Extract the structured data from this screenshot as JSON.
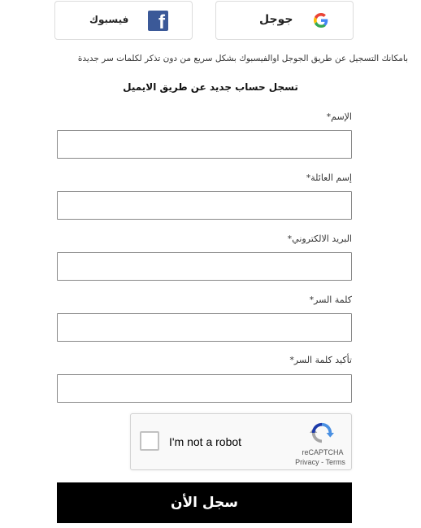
{
  "social": {
    "google_label": "جوجل",
    "facebook_label": "فيسبوك"
  },
  "info_text": "بامكانك التسجيل عن طريق الجوجل اوالفيسبوك بشكل سريع من دون تذكر لكلمات سر جديدة",
  "form_heading": "تسجل حساب جديد عن طريق الايميل",
  "fields": [
    {
      "label": "الإسم*",
      "value": ""
    },
    {
      "label": "إسم العائلة*",
      "value": ""
    },
    {
      "label": "البريد الالكتروني*",
      "value": ""
    },
    {
      "label": "كلمة السر*",
      "value": ""
    },
    {
      "label": "تأكيد كلمة السر*",
      "value": ""
    }
  ],
  "captcha": {
    "text": "I'm not a robot",
    "brand": "reCAPTCHA",
    "privacy": "Privacy",
    "separator": "-",
    "terms": "Terms"
  },
  "submit_label": "سجل الأن",
  "colors": {
    "facebook_blue": "#3b5998",
    "submit_bg": "#000000"
  }
}
